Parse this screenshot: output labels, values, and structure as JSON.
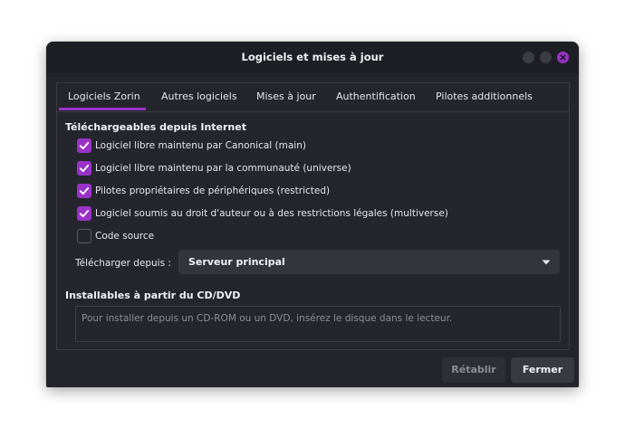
{
  "window": {
    "title": "Logiciels et mises à jour"
  },
  "tabs": [
    {
      "label": "Logiciels Zorin",
      "active": true
    },
    {
      "label": "Autres logiciels",
      "active": false
    },
    {
      "label": "Mises à jour",
      "active": false
    },
    {
      "label": "Authentification",
      "active": false
    },
    {
      "label": "Pilotes additionnels",
      "active": false
    }
  ],
  "internet": {
    "title": "Téléchargeables depuis Internet",
    "sources": [
      {
        "label": "Logiciel libre maintenu par Canonical (main)",
        "checked": true
      },
      {
        "label": "Logiciel libre maintenu par la communauté (universe)",
        "checked": true
      },
      {
        "label": "Pilotes propriétaires de périphériques (restricted)",
        "checked": true
      },
      {
        "label": "Logiciel soumis au droit d'auteur ou à des restrictions légales (multiverse)",
        "checked": true
      },
      {
        "label": "Code source",
        "checked": false
      }
    ],
    "download_from_label": "Télécharger depuis :",
    "download_from_value": "Serveur principal"
  },
  "cdrom": {
    "title": "Installables à partir du CD/DVD",
    "placeholder": "Pour installer depuis un CD-ROM ou un DVD, insérez le disque dans le lecteur."
  },
  "buttons": {
    "revert": "Rétablir",
    "close": "Fermer"
  },
  "colors": {
    "accent": "#9a32c8",
    "window_bg": "#24252c",
    "titlebar_bg": "#1e1f25"
  }
}
